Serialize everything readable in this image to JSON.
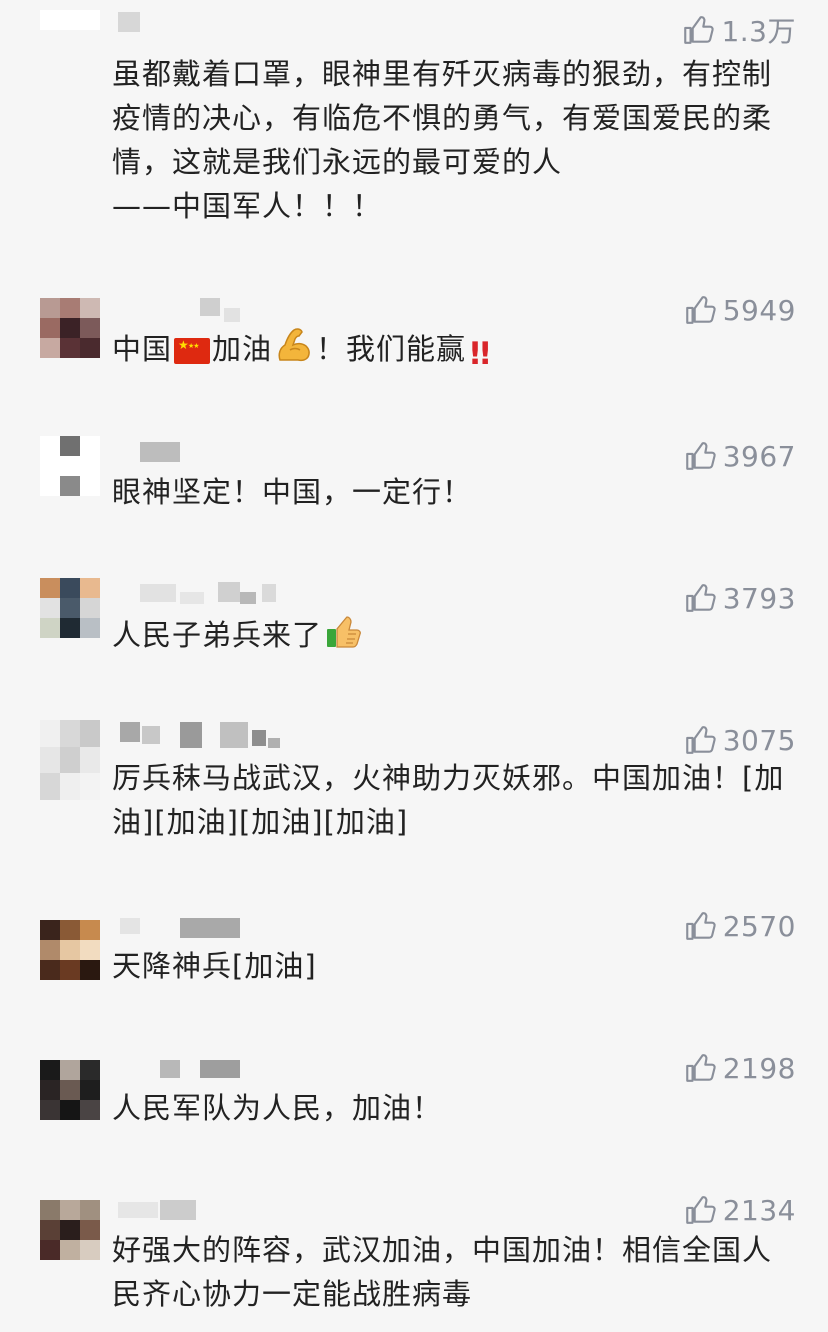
{
  "comments": [
    {
      "likes": "1.3万",
      "text": "虽都戴着口罩，眼神里有歼灭病毒的狠劲，有控制疫情的决心，有临危不惧的勇气，有爱国爱民的柔情，这就是我们永远的最可爱的人\n——中国军人！！！"
    },
    {
      "likes": "5949",
      "text_a": "中国",
      "text_b": "加油",
      "text_c": "！我们能赢",
      "emoji": [
        "flag-china-emoji",
        "flexed-biceps-emoji",
        "double-exclamation-emoji"
      ]
    },
    {
      "likes": "3967",
      "text": "眼神坚定！中国，一定行！"
    },
    {
      "likes": "3793",
      "text": "人民子弟兵来了",
      "emoji": [
        "thumbs-up-emoji"
      ]
    },
    {
      "likes": "3075",
      "text": "厉兵秣马战武汉，火神助力灭妖邪。中国加油！[加油][加油][加油][加油]"
    },
    {
      "likes": "2570",
      "text": "天降神兵[加油]"
    },
    {
      "likes": "2198",
      "text": "人民军队为人民，加油！"
    },
    {
      "likes": "2134",
      "text": "好强大的阵容，武汉加油，中国加油！相信全国人民齐心协力一定能战胜病毒"
    }
  ],
  "colors": {
    "background": "#f6f6f6",
    "text": "#222222",
    "like": "#8a8f9a"
  },
  "icons": {
    "like": "thumbs-up-outline-icon"
  }
}
